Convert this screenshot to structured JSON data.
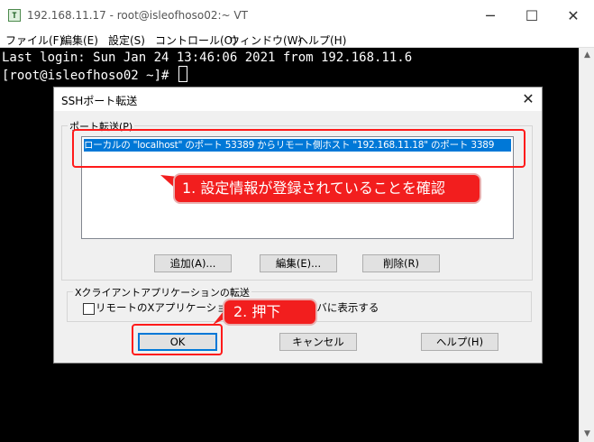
{
  "window": {
    "title": "192.168.11.17 - root@isleofhoso02:~ VT",
    "icon_label": "T",
    "min_glyph": "─",
    "max_glyph": "☐",
    "close_glyph": "✕"
  },
  "menu": [
    "ファイル(F)",
    "編集(E)",
    "設定(S)",
    "コントロール(O)",
    "ウィンドウ(W)",
    "ヘルプ(H)"
  ],
  "terminal": {
    "line1": "Last login: Sun Jan 24 13:46:06 2021 from 192.168.11.6",
    "line2": "[root@isleofhoso02 ~]# "
  },
  "dialog": {
    "title": "SSHポート転送",
    "close_glyph": "✕",
    "port_group_label": "ポート転送(P)",
    "list_items": [
      "ローカルの \"localhost\" のポート 53389 からリモート側ホスト \"192.168.11.18\" のポート 3389"
    ],
    "add_button": "追加(A)...",
    "edit_button": "編集(E)...",
    "delete_button": "削除(R)",
    "x_group_label": "Xクライアントアプリケーションの転送",
    "x_checkbox_label": "リモートのXアプリケーションをローカルXサーバに表示する",
    "ok_button": "OK",
    "cancel_button": "キャンセル",
    "help_button": "ヘルプ(H)"
  },
  "annotations": {
    "callout1": "1. 設定情報が登録されていることを確認",
    "callout2": "2. 押下",
    "color": "#f21e1e"
  }
}
